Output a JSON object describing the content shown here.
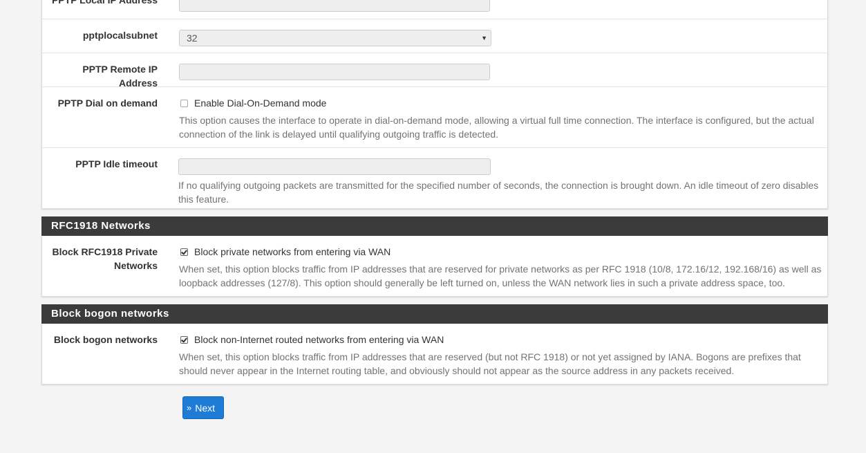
{
  "pptp": {
    "local_ip_label": "PPTP Local IP Address",
    "local_subnet_label": "pptplocalsubnet",
    "local_subnet_value": "32",
    "remote_ip_label": "PPTP Remote IP Address",
    "dial_on_demand_label": "PPTP Dial on demand",
    "dial_on_demand_checkbox": "Enable Dial-On-Demand mode",
    "dial_on_demand_help": "This option causes the interface to operate in dial-on-demand mode, allowing a virtual full time connection. The interface is configured, but the actual connection of the link is delayed until qualifying outgoing traffic is detected.",
    "idle_timeout_label": "PPTP Idle timeout",
    "idle_timeout_help": "If no qualifying outgoing packets are transmitted for the specified number of seconds, the connection is brought down. An idle timeout of zero disables this feature."
  },
  "rfc1918": {
    "section_title": "RFC1918 Networks",
    "label": "Block RFC1918 Private Networks",
    "checkbox": "Block private networks from entering via WAN",
    "checked": true,
    "help": "When set, this option blocks traffic from IP addresses that are reserved for private networks as per RFC 1918 (10/8, 172.16/12, 192.168/16) as well as loopback addresses (127/8). This option should generally be left turned on, unless the WAN network lies in such a private address space, too."
  },
  "bogon": {
    "section_title": "Block bogon networks",
    "label": "Block bogon networks",
    "checkbox": "Block non-Internet routed networks from entering via WAN",
    "checked": true,
    "help": "When set, this option blocks traffic from IP addresses that are reserved (but not RFC 1918) or not yet assigned by IANA. Bogons are prefixes that should never appear in the Internet routing table, and obviously should not appear as the source address in any packets received."
  },
  "actions": {
    "next_label": "Next",
    "next_icon": "double-chevron-right-icon"
  },
  "colors": {
    "section_header": "#3b3b3b",
    "primary_button": "#1e7bd6"
  }
}
